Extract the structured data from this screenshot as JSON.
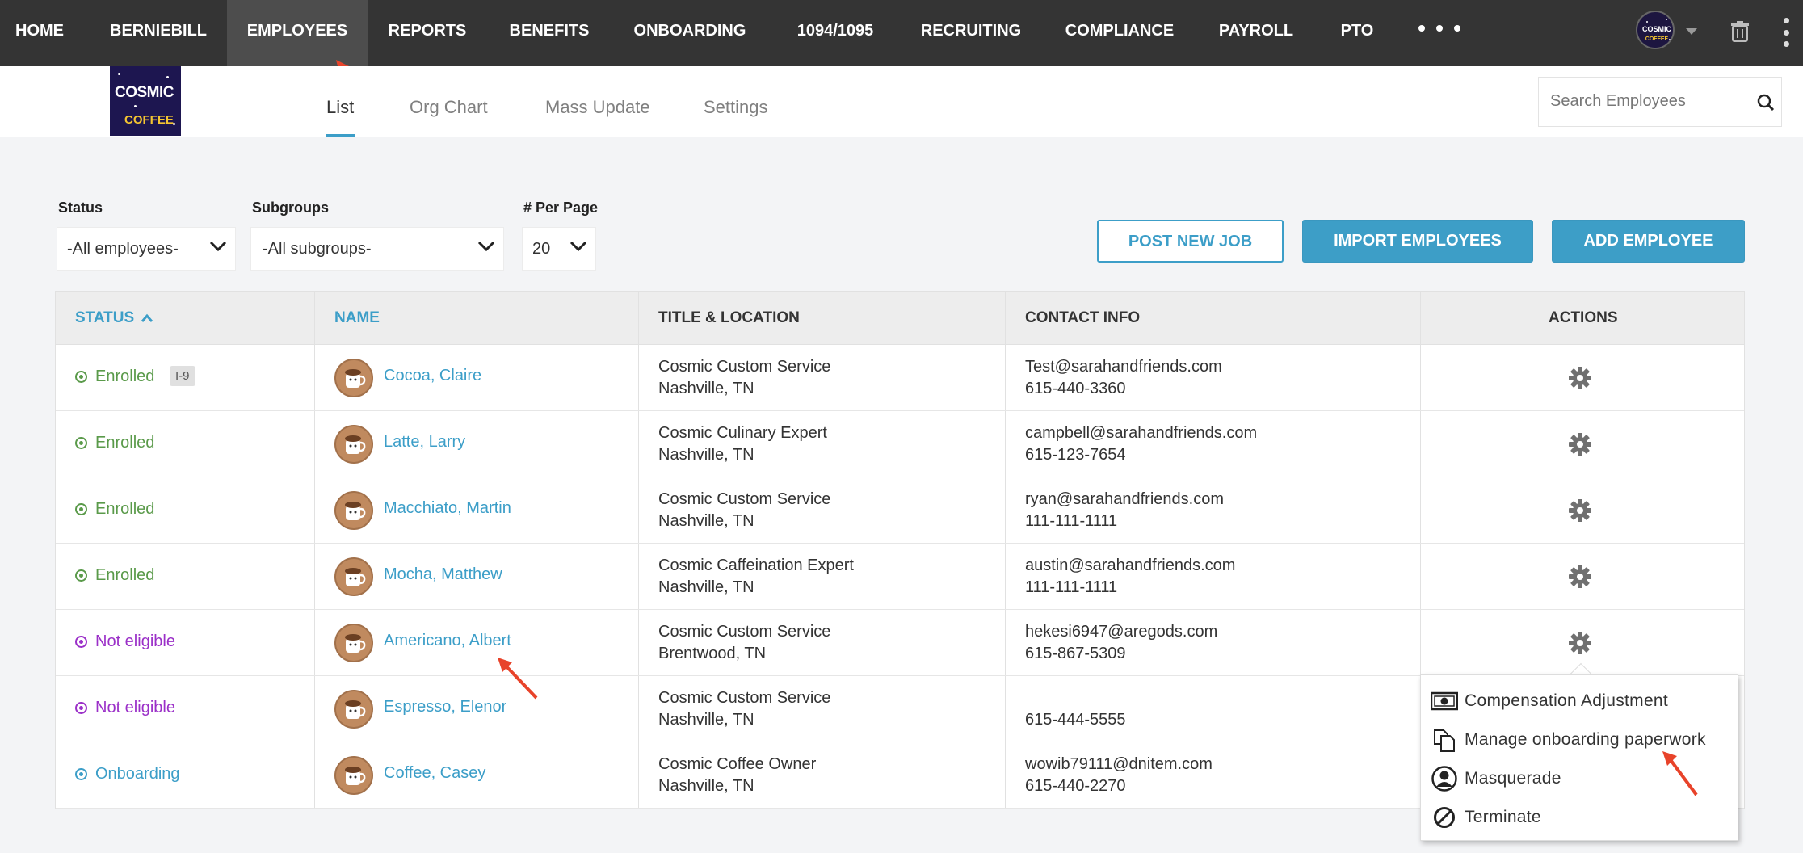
{
  "nav": {
    "items": [
      "HOME",
      "BERNIEBILL",
      "EMPLOYEES",
      "REPORTS",
      "BENEFITS",
      "ONBOARDING",
      "1094/1095",
      "RECRUITING",
      "COMPLIANCE",
      "PAYROLL",
      "PTO"
    ],
    "active": "EMPLOYEES"
  },
  "logo": {
    "line1": "COSMIC",
    "line2": "COFFEE"
  },
  "avatar_logo": {
    "line1": "COSMIC",
    "line2": "COFFEE"
  },
  "tabs": [
    "List",
    "Org Chart",
    "Mass Update",
    "Settings"
  ],
  "active_tab": "List",
  "search": {
    "placeholder": "Search Employees"
  },
  "filters": {
    "status": {
      "label": "Status",
      "value": "-All employees-"
    },
    "subgroups": {
      "label": "Subgroups",
      "value": "-All subgroups-"
    },
    "per_page": {
      "label": "# Per Page",
      "value": "20"
    }
  },
  "buttons": {
    "post_job": "POST NEW JOB",
    "import": "IMPORT EMPLOYEES",
    "add": "ADD EMPLOYEE"
  },
  "table": {
    "headers": {
      "status": "STATUS",
      "name": "NAME",
      "title": "TITLE & LOCATION",
      "contact": "CONTACT INFO",
      "actions": "ACTIONS"
    },
    "rows": [
      {
        "status": "Enrolled",
        "badge": "I-9",
        "name": "Cocoa, Claire",
        "title": "Cosmic Custom Service",
        "location": "Nashville, TN",
        "email": "Test@sarahandfriends.com",
        "phone": "615-440-3360"
      },
      {
        "status": "Enrolled",
        "badge": "",
        "name": "Latte, Larry",
        "title": "Cosmic Culinary Expert",
        "location": "Nashville, TN",
        "email": "campbell@sarahandfriends.com",
        "phone": "615-123-7654"
      },
      {
        "status": "Enrolled",
        "badge": "",
        "name": "Macchiato, Martin",
        "title": "Cosmic Custom Service",
        "location": "Nashville, TN",
        "email": "ryan@sarahandfriends.com",
        "phone": "111-111-1111"
      },
      {
        "status": "Enrolled",
        "badge": "",
        "name": "Mocha, Matthew",
        "title": "Cosmic Caffeination Expert",
        "location": "Nashville, TN",
        "email": "austin@sarahandfriends.com",
        "phone": "111-111-1111"
      },
      {
        "status": "Not eligible",
        "badge": "",
        "name": "Americano, Albert",
        "title": "Cosmic Custom Service",
        "location": "Brentwood, TN",
        "email": "hekesi6947@aregods.com",
        "phone": "615-867-5309"
      },
      {
        "status": "Not eligible",
        "badge": "",
        "name": "Espresso, Elenor",
        "title": "Cosmic Custom Service",
        "location": "Nashville, TN",
        "email": "",
        "phone": "615-444-5555"
      },
      {
        "status": "Onboarding",
        "badge": "",
        "name": "Coffee, Casey",
        "title": "Cosmic Coffee Owner",
        "location": "Nashville, TN",
        "email": "wowib79111@dnitem.com",
        "phone": "615-440-2270"
      }
    ]
  },
  "menu": {
    "items": [
      "Compensation Adjustment",
      "Manage onboarding paperwork",
      "Masquerade",
      "Terminate"
    ]
  },
  "colors": {
    "enrolled": "#5a9a4a",
    "not_eligible": "#9b30c8",
    "onboarding": "#3c9ec8",
    "accent": "#3c9ec8",
    "annotation_arrow": "#e8432a"
  }
}
